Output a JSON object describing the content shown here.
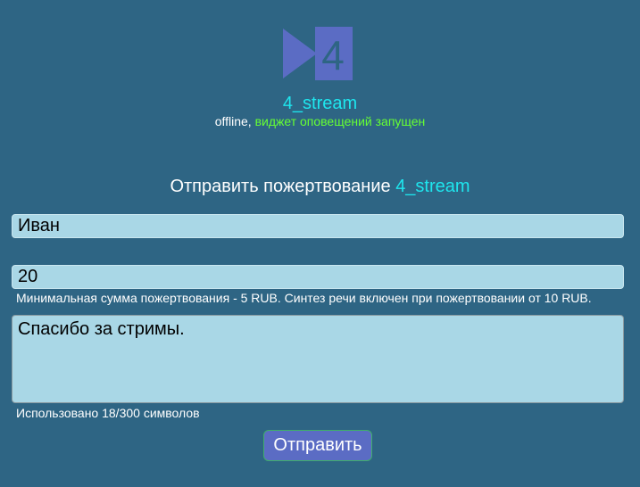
{
  "channel": {
    "logo_text": "4",
    "name": "4_stream",
    "status_offline": "offline",
    "status_separator": ", ",
    "status_widget": "виджет оповещений запущен"
  },
  "form": {
    "heading_prefix": "Отправить пожертвование ",
    "heading_channel": "4_stream",
    "name_value": "Иван",
    "amount_value": "20",
    "min_hint": "Минимальная сумма пожертвования - 5 RUB. Синтез речи включен при пожертвовании от 10 RUB.",
    "message_value": "Спасибо за стримы.",
    "char_count_text": "Использовано 18/300 символов",
    "submit_label": "Отправить"
  },
  "colors": {
    "background": "#2e6584",
    "accent_cyan": "#1ee6ee",
    "widget_green": "#66ff33",
    "logo_blue": "#5b6cc4",
    "field_bg": "#a9d7e6",
    "button_bg": "#5b6cc4"
  },
  "icons": {
    "logo": "play-arrow-with-digit-logo"
  }
}
